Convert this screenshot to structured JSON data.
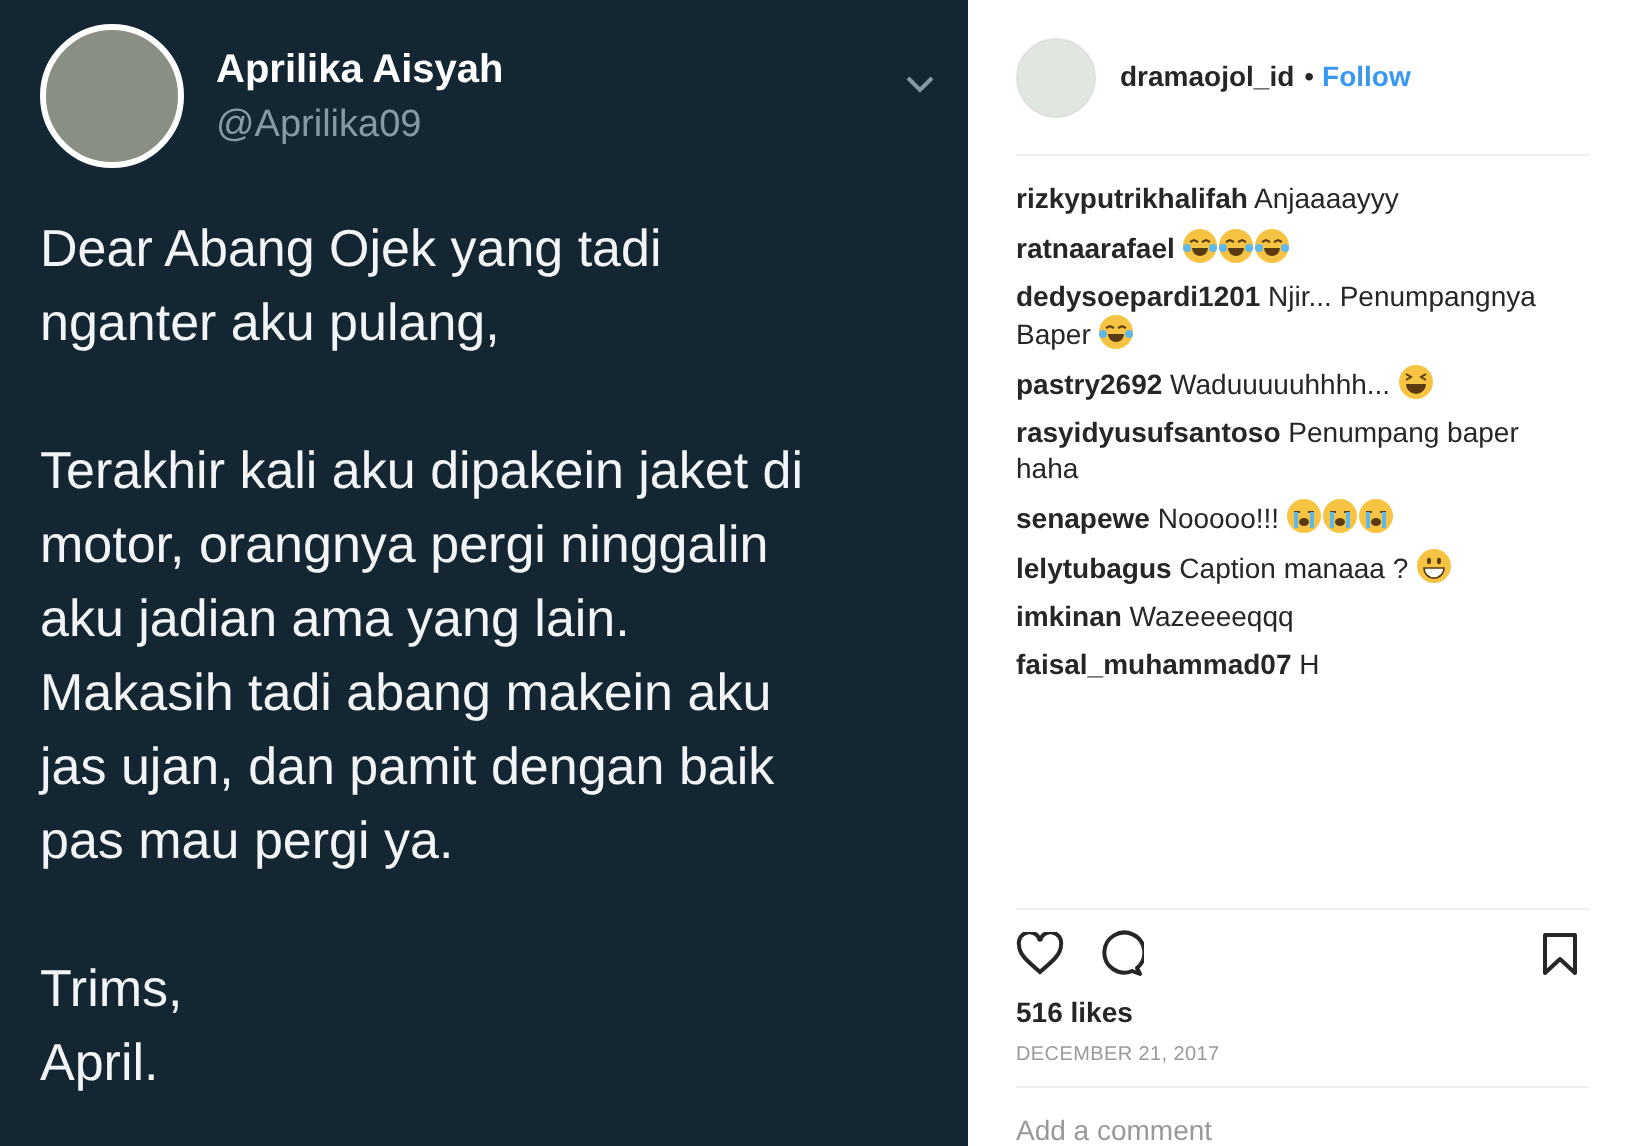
{
  "tweet": {
    "name": "Aprilika Aisyah",
    "handle": "@Aprilika09",
    "paragraphs": [
      "Dear Abang Ojek yang tadi\nnganter aku pulang,",
      "Terakhir kali aku dipakein jaket di\nmotor, orangnya pergi ninggalin\naku jadian ama yang lain.\nMakasih tadi abang makein aku\njas ujan, dan pamit dengan baik\npas mau pergi ya.",
      "Trims,\nApril."
    ]
  },
  "post": {
    "username": "dramaojol_id",
    "separator": "•",
    "follow": "Follow",
    "comments": [
      {
        "user": "rizkyputrikhalifah",
        "text": "Anjaaaayyy"
      },
      {
        "user": "ratnaarafael",
        "emojis": [
          {
            "kind": "tears_of_joy"
          },
          {
            "kind": "tears_of_joy"
          },
          {
            "kind": "tears_of_joy"
          }
        ]
      },
      {
        "user": "dedysoepardi1201",
        "text": "Njir... Penumpangnya Baper",
        "emojis": [
          {
            "kind": "tears_of_joy"
          }
        ]
      },
      {
        "user": "pastry2692",
        "text": "Waduuuuuhhhh...",
        "emojis": [
          {
            "kind": "squint_grin"
          }
        ]
      },
      {
        "user": "rasyidyusufsantoso",
        "text": "Penumpang baper haha"
      },
      {
        "user": "senapewe",
        "text": "Nooooo!!!",
        "emojis": [
          {
            "kind": "crying"
          },
          {
            "kind": "crying"
          },
          {
            "kind": "crying"
          }
        ]
      },
      {
        "user": "lelytubagus",
        "text": "Caption manaaa ?",
        "emojis": [
          {
            "kind": "grin"
          }
        ]
      },
      {
        "user": "imkinan",
        "text": "Wazeeeeqqq"
      },
      {
        "user": "faisal_muhammad07",
        "text": "H"
      }
    ],
    "likes": "516 likes",
    "date": "DECEMBER 21, 2017",
    "comment_placeholder": "Add a comment"
  }
}
